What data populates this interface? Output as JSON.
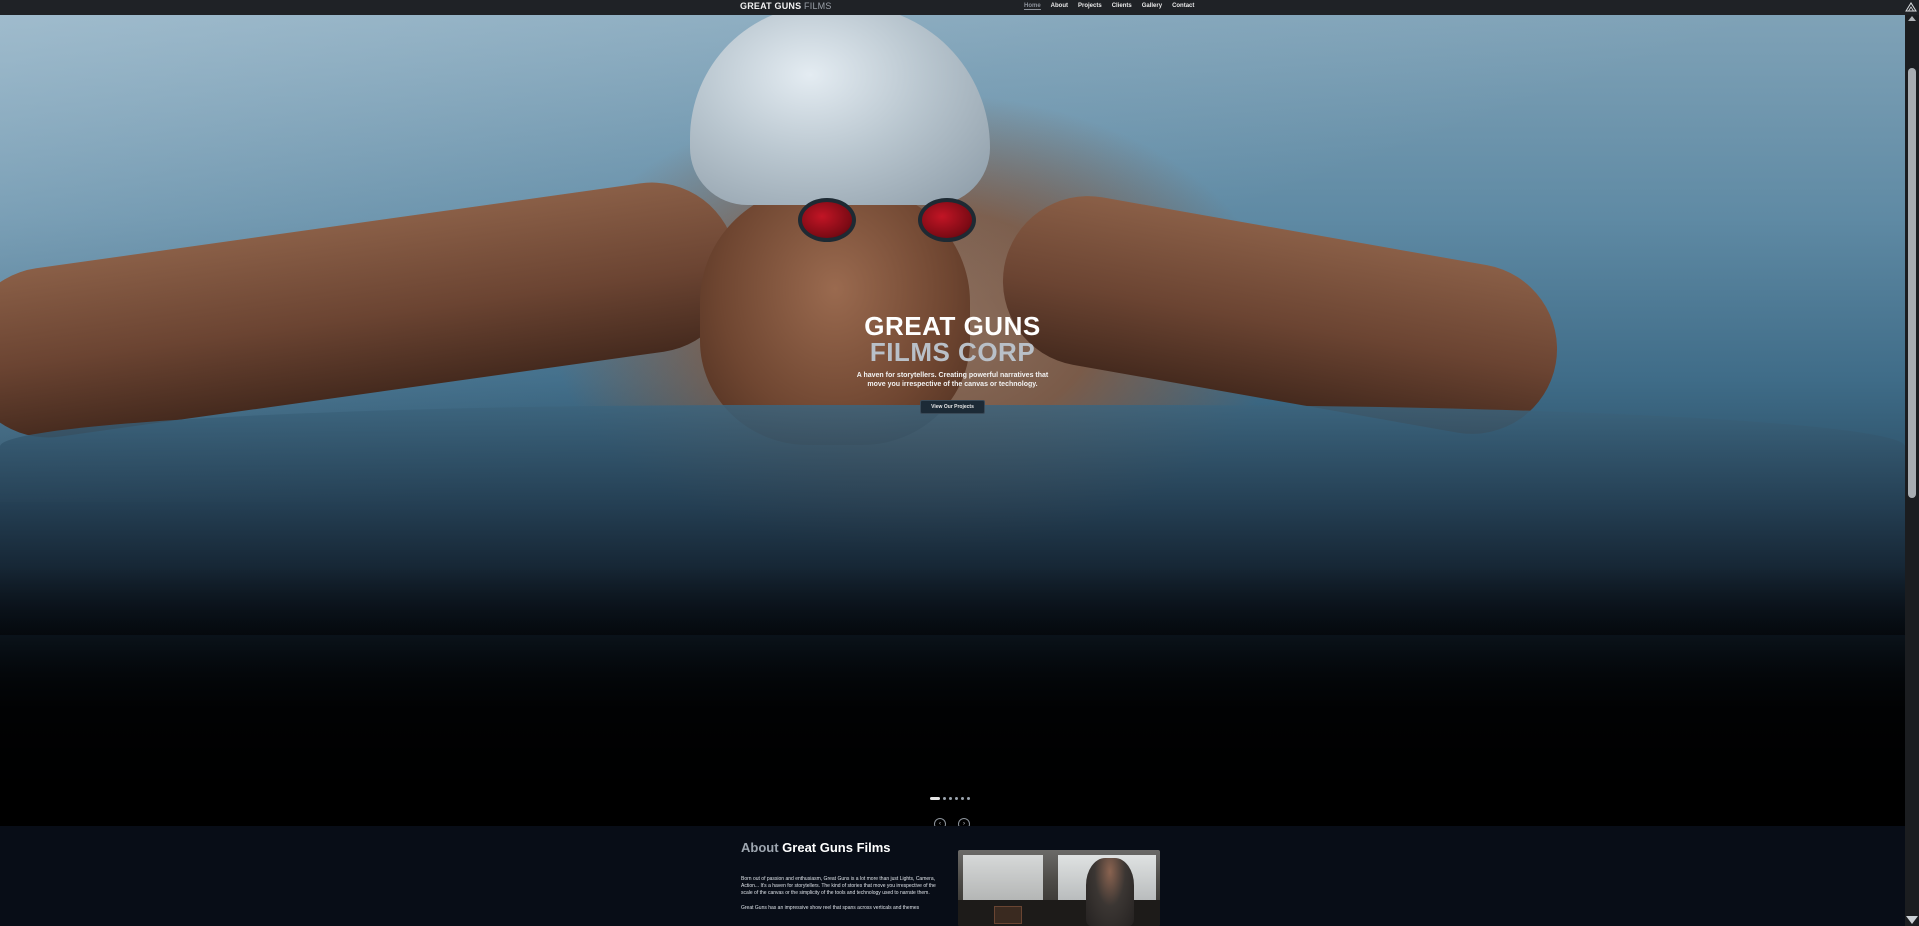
{
  "nav": {
    "brand_main": "GREAT GUNS",
    "brand_sub": "FILMS",
    "items": [
      {
        "label": "Home",
        "active": true
      },
      {
        "label": "About",
        "active": false
      },
      {
        "label": "Projects",
        "active": false
      },
      {
        "label": "Clients",
        "active": false
      },
      {
        "label": "Gallery",
        "active": false
      },
      {
        "label": "Contact",
        "active": false
      }
    ],
    "corner_icon": "logo-triangle-icon"
  },
  "hero": {
    "title_line1": "GREAT GUNS",
    "title_line2": "FILMS CORP",
    "tagline": "A haven for storytellers. Creating powerful narratives that move you irrespective of the canvas or technology.",
    "cta_label": "View Our Projects",
    "slide_count": 6,
    "active_slide": 1,
    "prev_label": "‹",
    "next_label": "›"
  },
  "about": {
    "title_part1": "About",
    "title_part2": "Great Guns Films",
    "paragraph1": "Born out of passion and enthusiasm, Great Guns is a lot more than just Lights, Camera, Action... It's a haven for storytellers. The kind of stories that move you irrespective of the scale of the canvas or the simplicity of the tools and technology used to narrate them.",
    "paragraph2": "Great Guns has an impressive show reel that spans across verticals and themes"
  },
  "colors": {
    "topbar": "#1f2226",
    "about_bg": "#080d17",
    "accent_gray": "#b9c0c8"
  }
}
